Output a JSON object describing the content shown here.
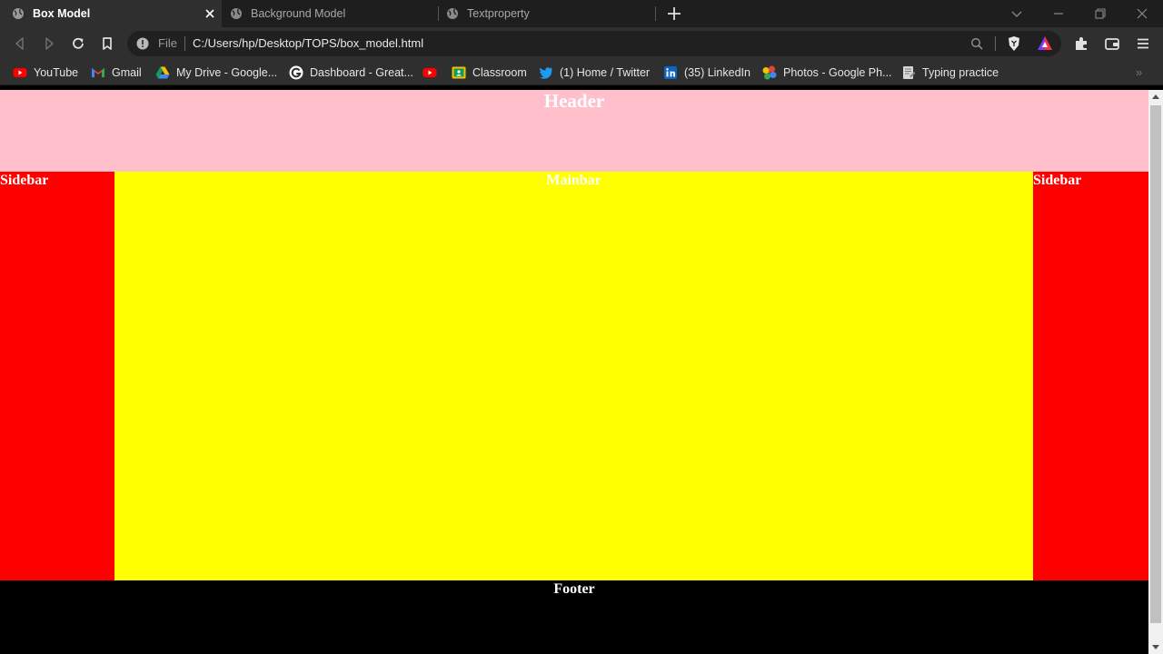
{
  "tabs": [
    {
      "label": "Box Model",
      "active": true
    },
    {
      "label": "Background Model",
      "active": false
    },
    {
      "label": "Textproperty",
      "active": false
    }
  ],
  "addressbar": {
    "security_label": "File",
    "url": "C:/Users/hp/Desktop/TOPS/box_model.html"
  },
  "bookmarks": [
    {
      "label": "YouTube",
      "icon": "youtube-icon"
    },
    {
      "label": "Gmail",
      "icon": "gmail-icon"
    },
    {
      "label": "My Drive - Google...",
      "icon": "google-drive-icon"
    },
    {
      "label": "Dashboard - Great...",
      "icon": "great-learning-icon"
    },
    {
      "label": "",
      "icon": "youtube-icon"
    },
    {
      "label": "Classroom",
      "icon": "google-classroom-icon"
    },
    {
      "label": "(1) Home / Twitter",
      "icon": "twitter-icon"
    },
    {
      "label": "(35) LinkedIn",
      "icon": "linkedin-icon"
    },
    {
      "label": "Photos - Google Ph...",
      "icon": "google-photos-icon"
    },
    {
      "label": "Typing practice",
      "icon": "typing-icon"
    }
  ],
  "page": {
    "header": "Header",
    "sidebar_left": "Sidebar",
    "mainbar": "Mainbar",
    "sidebar_right": "Sidebar",
    "footer": "Footer"
  },
  "colors": {
    "header_bg": "#ffc0cb",
    "sidebar_bg": "#ff0000",
    "mainbar_bg": "#ffff00",
    "footer_bg": "#000000",
    "text": "#ffffff"
  }
}
